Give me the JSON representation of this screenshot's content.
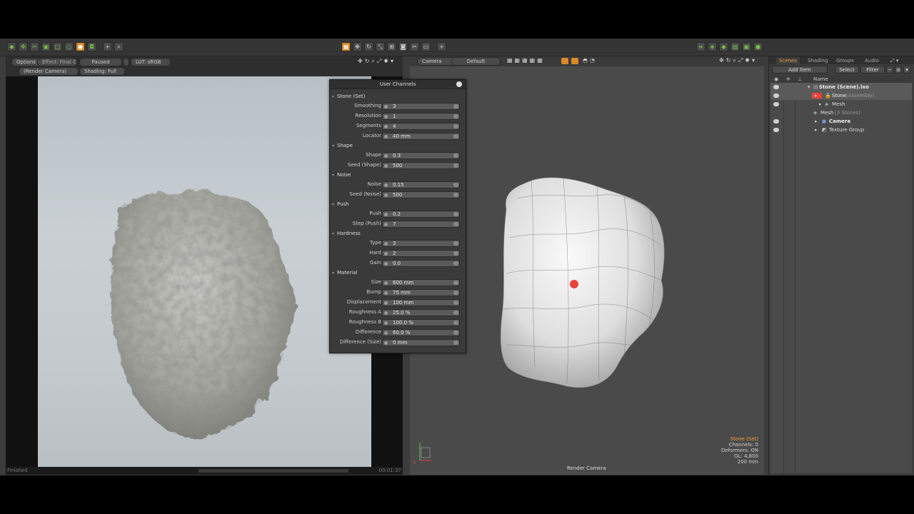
{
  "render_view": {
    "options_label": "Options",
    "effect_label": "Effect: Final C...",
    "state_label": "Paused",
    "lut_label": "LUT: sRGB",
    "camera_label": "(Render Camera)",
    "shading_label": "Shading: Full",
    "status_left": "Finished",
    "status_right": "00:01:37"
  },
  "viewport": {
    "camera_label": "Camera",
    "preset_label": "Default",
    "hud": {
      "selection": "Stone (Set)",
      "channels": "Channels: 0",
      "deformers": "Deformers: ON",
      "gl": "GL: 4,800",
      "scale": "200 mm"
    },
    "footer_label": "Render Camera",
    "axis_x": "X",
    "axis_y": "Y"
  },
  "user_channels": {
    "title": "User Channels",
    "sections": [
      {
        "name": "Stone (Set)",
        "rows": [
          {
            "label": "Smoothing",
            "value": "3"
          },
          {
            "label": "Resolution",
            "value": "1"
          },
          {
            "label": "Segments",
            "value": "4"
          },
          {
            "label": "Locator",
            "value": "40 mm"
          }
        ]
      },
      {
        "name": "Shape",
        "rows": [
          {
            "label": "Shape",
            "value": "0.3"
          },
          {
            "label": "Seed (Shape)",
            "value": "500"
          }
        ]
      },
      {
        "name": "Noise",
        "rows": [
          {
            "label": "Noise",
            "value": "0.15"
          },
          {
            "label": "Seed (Noise)",
            "value": "500"
          }
        ]
      },
      {
        "name": "Push",
        "rows": [
          {
            "label": "Push",
            "value": "0.2"
          },
          {
            "label": "Step (Push)",
            "value": "7"
          }
        ]
      },
      {
        "name": "Hardness",
        "rows": [
          {
            "label": "Type",
            "value": "3"
          },
          {
            "label": "Hard",
            "value": "2"
          },
          {
            "label": "Gain",
            "value": "0.0"
          }
        ]
      },
      {
        "name": "Material",
        "rows": [
          {
            "label": "Size",
            "value": "600 mm"
          },
          {
            "label": "Bump",
            "value": "75 mm"
          },
          {
            "label": "Displacement",
            "value": "100 mm"
          },
          {
            "label": "Roughness A",
            "value": "25.0 %"
          },
          {
            "label": "Roughness B",
            "value": "100.0 %"
          },
          {
            "label": "Difference",
            "value": "60.0 %"
          },
          {
            "label": "Difference (Size)",
            "value": "0 mm"
          }
        ]
      }
    ]
  },
  "scene_panel": {
    "tabs": [
      "Scenes",
      "Shading",
      "Groups",
      "Audio"
    ],
    "add_item_label": "Add Item",
    "select_label": "Select",
    "filter_label": "Filter",
    "column_name": "Name",
    "items": [
      {
        "label": "Stone (Scene).lxo",
        "bold": true
      },
      {
        "label": "Stone",
        "suffix": "(Assembly)"
      },
      {
        "label": "Mesh"
      },
      {
        "label": "Mesh",
        "suffix": "(3 Stones)"
      },
      {
        "label": "Camera",
        "bold": true
      },
      {
        "label": "Texture Group"
      }
    ]
  },
  "colors": {
    "accent_orange": "#d98a2b",
    "tool_green": "#74c043",
    "selection_red": "#e8423a",
    "tab_active": "#f0a040"
  }
}
